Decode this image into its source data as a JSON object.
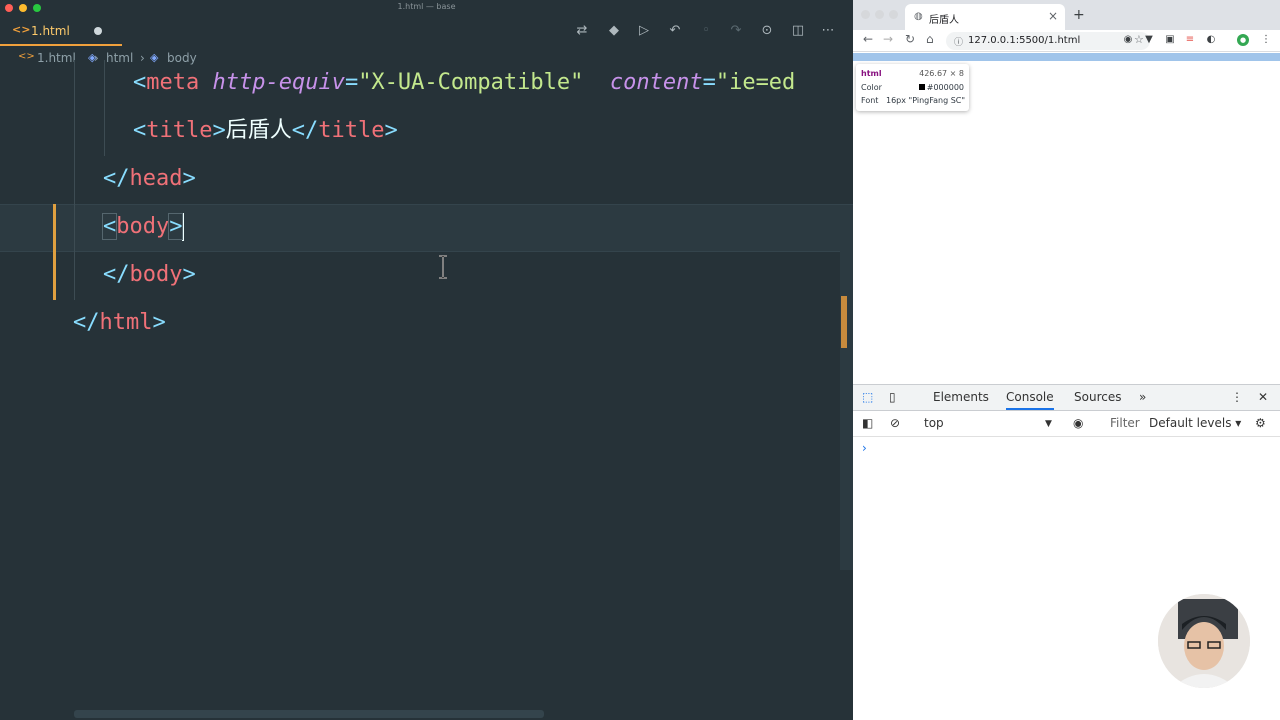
{
  "window_title": "1.html — base",
  "editor": {
    "tab": {
      "icon": "code-brackets-icon",
      "label": "1.html"
    },
    "breadcrumb": [
      "1.html",
      "html",
      "body"
    ],
    "code": {
      "meta": {
        "tag": "meta",
        "attr1": "http-equiv",
        "val1": "\"X-UA-Compatible\"",
        "attr2": "content",
        "val2": "\"ie=ed"
      },
      "title": {
        "tag": "title",
        "text": "后盾人"
      },
      "head_close": "head",
      "body_open": "body",
      "body_close": "body",
      "html_close": "html"
    }
  },
  "browser": {
    "tab_title": "后盾人",
    "url": "127.0.0.1:5500/1.html",
    "tooltip": {
      "element": "html",
      "size": "426.67 × 8",
      "color_label": "Color",
      "color_value": "#000000",
      "font_label": "Font",
      "font_value": "16px \"PingFang SC\""
    },
    "devtools": {
      "tabs": [
        "Elements",
        "Console",
        "Sources"
      ],
      "active_tab": "Console",
      "context": "top",
      "filter_placeholder": "Filter",
      "levels": "Default levels ▾",
      "prompt": "›"
    }
  },
  "colors": {
    "accent": "#f0a03c",
    "editor_bg": "#263238",
    "tag": "#f07178",
    "attr": "#c792ea",
    "string": "#c3e88d"
  }
}
